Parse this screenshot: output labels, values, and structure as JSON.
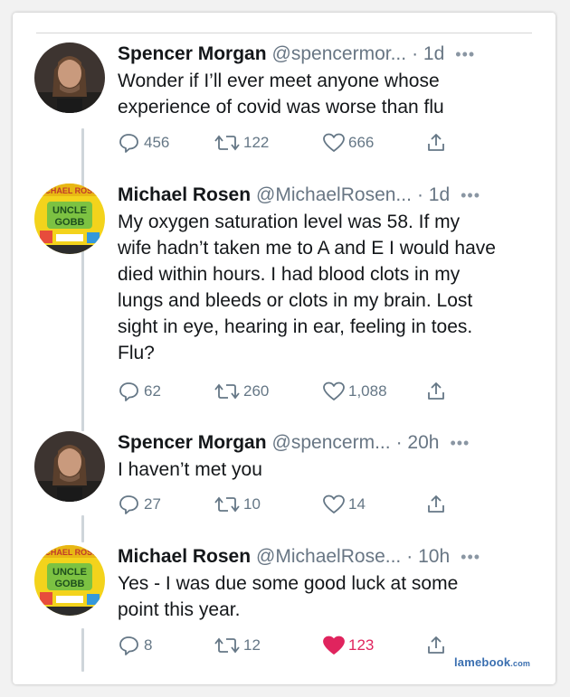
{
  "tweets": [
    {
      "name": "Spencer Morgan",
      "handle": "@spencermor...",
      "time": "· 1d",
      "text": "Wonder if I’ll ever meet anyone whose experience of covid was worse than flu",
      "replies": "456",
      "retweets": "122",
      "likes": "666",
      "liked": false,
      "avatar": "man-photo"
    },
    {
      "name": "Michael Rosen",
      "handle": "@MichaelRosen...",
      "time": "· 1d",
      "text": "My oxygen saturation level was 58. If my wife hadn’t taken me to A and E I would have died within hours. I had blood clots in my lungs and bleeds or clots in my brain. Lost sight in eye, hearing in ear, feeling in toes. Flu?",
      "replies": "62",
      "retweets": "260",
      "likes": "1,088",
      "liked": false,
      "avatar": "book-cover"
    },
    {
      "name": "Spencer Morgan",
      "handle": "@spencerm...",
      "time": "· 20h",
      "text": "I haven’t met you",
      "replies": "27",
      "retweets": "10",
      "likes": "14",
      "liked": false,
      "avatar": "man-photo"
    },
    {
      "name": "Michael Rosen",
      "handle": "@MichaelRose...",
      "time": "· 10h",
      "text": "Yes -  I was due some good luck at some point this year.",
      "replies": "8",
      "retweets": "12",
      "likes": "123",
      "liked": true,
      "avatar": "book-cover"
    }
  ],
  "more_glyph": "•••",
  "watermark": {
    "main": "lamebook",
    "suffix": ".com"
  },
  "colors": {
    "like_active": "#e0245e",
    "icon_gray": "#657786",
    "text": "#14171a",
    "thread_line": "#cfd5da"
  }
}
